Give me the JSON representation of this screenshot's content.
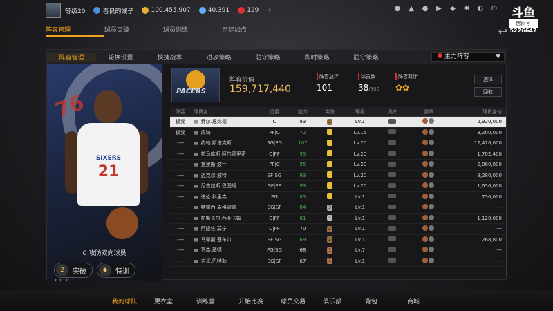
{
  "topbar": {
    "level": "等级20",
    "buff": "善良的嫂子",
    "gold": "100,455,907",
    "gems": "40,391",
    "tickets": "129",
    "plus": "+"
  },
  "douyu": {
    "logo": "斗鱼",
    "room_label": "房间号",
    "room_id": "5226647"
  },
  "main_tabs": [
    "阵容管理",
    "球员突破",
    "球员训练",
    "自建加点"
  ],
  "sub_tabs": [
    "阵容管理",
    "轮换设置",
    "快捷战术",
    "进攻策略",
    "防守策略",
    "即时策略",
    "防守策略"
  ],
  "lineup_select": "主力阵容",
  "header": {
    "value_label": "阵容价值",
    "value": "159,717,440",
    "rating_label": "阵容总评",
    "rating": "101",
    "count_label": "球员数",
    "count": "38",
    "count_max": "/300",
    "bond_label": "阵容羁绊",
    "select_btn": "选择",
    "recycle_btn": "回收"
  },
  "left_card": {
    "jersey": "SIXERS",
    "number": "21",
    "role": "C 攻防双向球员",
    "break_level": "2",
    "break_label": "突破",
    "train_label": "特训"
  },
  "table": {
    "headers": [
      "阵容",
      "球员名",
      "位置",
      "能力",
      "突破",
      "等级",
      "训练",
      "徽章",
      "球员身价"
    ],
    "rows": [
      {
        "slot": "板凳",
        "name": "乔尔.恩比德",
        "pos": "C",
        "ability": "83",
        "tupo": "2",
        "level": "Lv.1",
        "price": "2,920,000",
        "green": false
      },
      {
        "slot": "板凳",
        "name": "周琦",
        "pos": "PF|C",
        "ability": "72",
        "tupo": "",
        "level": "Lv.15",
        "price": "3,200,000",
        "green": true
      },
      {
        "slot": "----",
        "name": "约翰.斯塔克斯",
        "pos": "SG|PG",
        "ability": "107",
        "tupo": "",
        "level": "Lv.20",
        "price": "12,416,000",
        "green": true
      },
      {
        "slot": "----",
        "name": "拉马库斯.阿尔德里奇",
        "pos": "C|PF",
        "ability": "95",
        "tupo": "",
        "level": "Lv.20",
        "price": "1,702,400",
        "green": true
      },
      {
        "slot": "----",
        "name": "克里斯.波什",
        "pos": "PF|C",
        "ability": "95",
        "tupo": "",
        "level": "Lv.20",
        "price": "2,860,800",
        "green": true
      },
      {
        "slot": "----",
        "name": "迈克尔.波特",
        "pos": "SF|SG",
        "ability": "93",
        "tupo": "",
        "level": "Lv.20",
        "price": "9,280,000",
        "green": true
      },
      {
        "slot": "----",
        "name": "尼古拉斯.巴图姆",
        "pos": "SF|PF",
        "ability": "93",
        "tupo": "",
        "level": "Lv.20",
        "price": "1,656,000",
        "green": true
      },
      {
        "slot": "----",
        "name": "达伦.科里森",
        "pos": "PG",
        "ability": "85",
        "tupo": "",
        "level": "Lv.1",
        "price": "736,000",
        "green": true
      },
      {
        "slot": "----",
        "name": "特雷西.麦格雷迪",
        "pos": "SG|SF",
        "ability": "84",
        "tupo": "3",
        "level": "Lv.1",
        "price": "---",
        "green": true
      },
      {
        "slot": "----",
        "name": "帕斯卡尔.西亚卡姆",
        "pos": "C|PF",
        "ability": "81",
        "tupo": "4",
        "level": "Lv.1",
        "price": "1,120,000",
        "green": true
      },
      {
        "slot": "----",
        "name": "阿隆佐.莫宁",
        "pos": "C|PF",
        "ability": "70",
        "tupo": "2",
        "level": "Lv.1",
        "price": "---",
        "green": false
      },
      {
        "slot": "----",
        "name": "马蒂斯.塞布尔",
        "pos": "SF|SG",
        "ability": "69",
        "tupo": "2",
        "level": "Lv.1",
        "price": "268,800",
        "green": true
      },
      {
        "slot": "----",
        "name": "贾森.基德",
        "pos": "PG|SG",
        "ability": "68",
        "tupo": "1",
        "level": "Lv.7",
        "price": "---",
        "green": false
      },
      {
        "slot": "----",
        "name": "吉米.巴特勒",
        "pos": "SG|SF",
        "ability": "67",
        "tupo": "1",
        "level": "Lv.1",
        "price": "---",
        "green": false
      }
    ]
  },
  "bottom_nav": [
    "我的球队",
    "更衣室",
    "训练营",
    "开始比赛",
    "球员交易",
    "俱乐部",
    "背包",
    "商城"
  ],
  "colors": {
    "accent": "#f0a020",
    "green": "#4cae4c",
    "brand_red": "#c0392b"
  }
}
